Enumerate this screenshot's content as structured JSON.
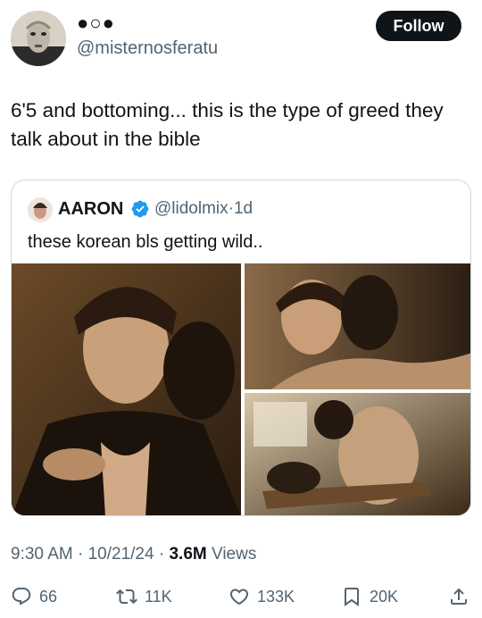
{
  "author": {
    "display_name": "●○●",
    "handle": "@misternosferatu",
    "avatar_icon": "nosferatu-avatar"
  },
  "follow_label": "Follow",
  "tweet": {
    "text": "6'5 and bottoming... this is the type of greed they talk about in the bible"
  },
  "quoted_tweet": {
    "name": "AARON",
    "verified_icon": "verified-badge-icon",
    "handle": "@lidolmix",
    "separator": "·",
    "age": "1d",
    "text": "these korean bls getting wild..",
    "media_count": 3
  },
  "meta": {
    "time": "9:30 AM",
    "date": "10/21/24",
    "separator": " · ",
    "views_count": "3.6M",
    "views_label": "Views"
  },
  "actions": {
    "replies": "66",
    "retweets": "11K",
    "likes": "133K",
    "bookmarks": "20K"
  },
  "colors": {
    "text": "#0f1419",
    "secondary": "#536471",
    "border": "#cfd9de",
    "verified": "#1d9bf0",
    "button_bg": "#0f1419"
  }
}
